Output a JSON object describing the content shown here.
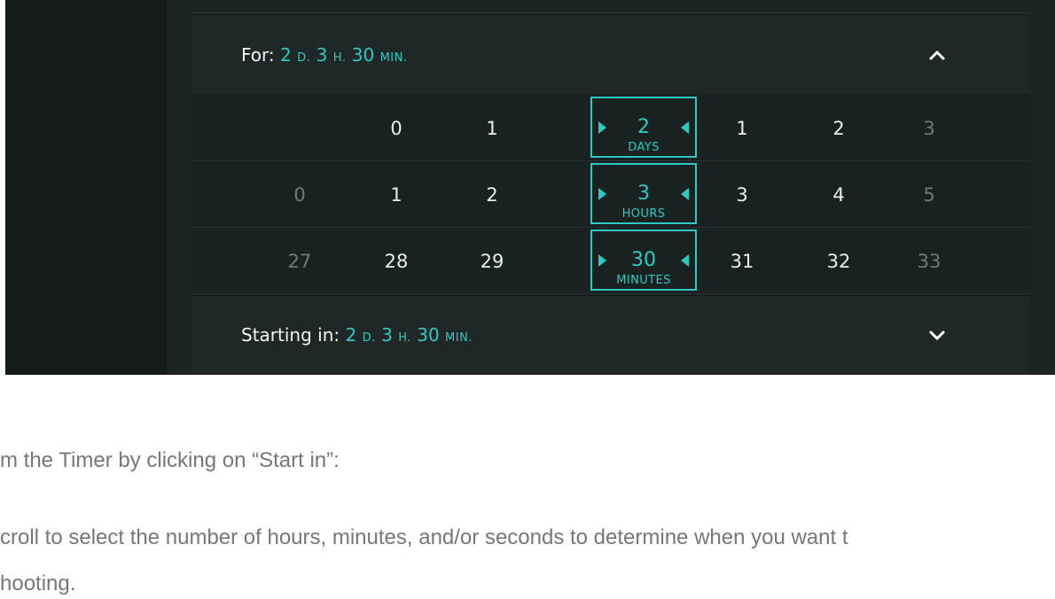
{
  "for_summary": {
    "label": "For:",
    "days": "2",
    "days_unit": "D.",
    "hours": "3",
    "hours_unit": "H.",
    "minutes": "30",
    "minutes_unit": "MIN."
  },
  "picker": {
    "days": {
      "values": [
        "0",
        "1",
        "1",
        "2",
        "3"
      ],
      "selected": "2",
      "unit": "DAYS"
    },
    "hours": {
      "values": [
        "0",
        "1",
        "2",
        "3",
        "4",
        "5"
      ],
      "selected": "3",
      "unit": "HOURS"
    },
    "minutes": {
      "values": [
        "27",
        "28",
        "29",
        "31",
        "32",
        "33"
      ],
      "selected": "30",
      "unit": "MINUTES"
    }
  },
  "start_summary": {
    "label": "Starting in:",
    "days": "2",
    "days_unit": "D.",
    "hours": "3",
    "hours_unit": "H.",
    "minutes": "30",
    "minutes_unit": "MIN."
  },
  "icons": {
    "collapse": "chevron-up-icon",
    "expand": "chevron-down-icon"
  },
  "colors": {
    "accent": "#2ec9c2",
    "background": "#1c2323"
  },
  "caption": {
    "line1": "m the Timer by clicking on “Start in”:",
    "line2": "croll to select the number of hours, minutes, and/or seconds to determine when you want t",
    "line3": "hooting."
  }
}
